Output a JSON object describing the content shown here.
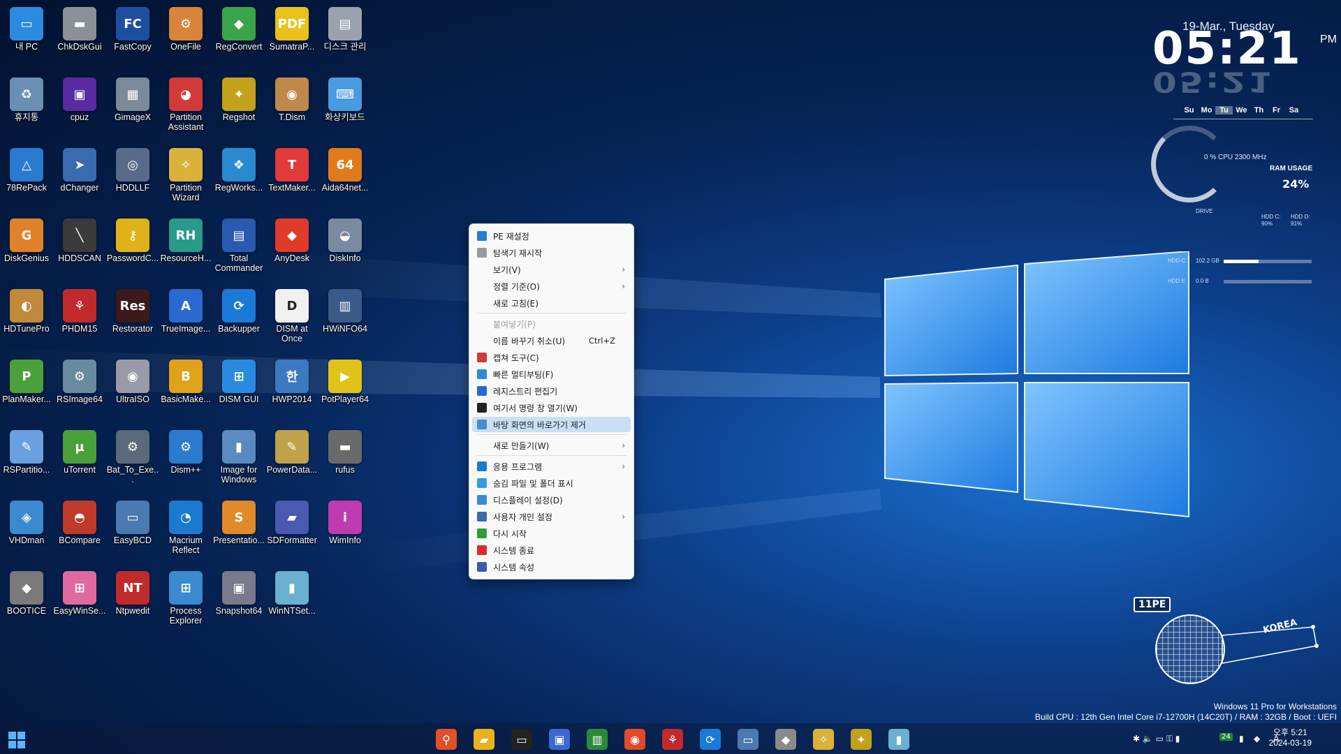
{
  "desktop_icons": [
    {
      "label": "내 PC",
      "glyph": "▭",
      "color": "#2a8be0"
    },
    {
      "label": "ChkDskGui",
      "glyph": "▬",
      "color": "#8a8f98"
    },
    {
      "label": "FastCopy",
      "glyph": "FC",
      "color": "#1d4fa0"
    },
    {
      "label": "OneFile",
      "glyph": "⚙",
      "color": "#d8843a"
    },
    {
      "label": "RegConvert",
      "glyph": "◆",
      "color": "#3aa44a"
    },
    {
      "label": "SumatraP...",
      "glyph": "PDF",
      "color": "#e8c21a"
    },
    {
      "label": "디스크 관리",
      "glyph": "▤",
      "color": "#9aa2ad"
    },
    {
      "label": "휴지통",
      "glyph": "♻",
      "color": "#6a8fb5"
    },
    {
      "label": "cpuz",
      "glyph": "▣",
      "color": "#5a2aa0"
    },
    {
      "label": "GimageX",
      "glyph": "▦",
      "color": "#7a8a9a"
    },
    {
      "label": "Partition Assistant",
      "glyph": "◕",
      "color": "#d23a3a"
    },
    {
      "label": "Regshot",
      "glyph": "✦",
      "color": "#c2a21a"
    },
    {
      "label": "T.Dism",
      "glyph": "◉",
      "color": "#c0884a"
    },
    {
      "label": "화상키보드",
      "glyph": "⌨",
      "color": "#4a9ae0"
    },
    {
      "label": "78RePack",
      "glyph": "△",
      "color": "#2a7ad0"
    },
    {
      "label": "dChanger",
      "glyph": "➤",
      "color": "#3a6ab0"
    },
    {
      "label": "HDDLLF",
      "glyph": "◎",
      "color": "#5a6a8a"
    },
    {
      "label": "Partition Wizard",
      "glyph": "✧",
      "color": "#d8b23a"
    },
    {
      "label": "RegWorks...",
      "glyph": "❖",
      "color": "#2a8ad0"
    },
    {
      "label": "TextMaker...",
      "glyph": "T",
      "color": "#e03a3a"
    },
    {
      "label": "Aida64net...",
      "glyph": "64",
      "color": "#e07a1a"
    },
    {
      "label": "DiskGenius",
      "glyph": "G",
      "color": "#e0822a"
    },
    {
      "label": "HDDSCAN",
      "glyph": "╲",
      "color": "#3a3a3a"
    },
    {
      "label": "PasswordC...",
      "glyph": "⚷",
      "color": "#e0b21a"
    },
    {
      "label": "ResourceH...",
      "glyph": "RH",
      "color": "#2a9a8a"
    },
    {
      "label": "Total Commander",
      "glyph": "▤",
      "color": "#2a5ab0"
    },
    {
      "label": "AnyDesk",
      "glyph": "◆",
      "color": "#e03a2a"
    },
    {
      "label": "DiskInfo",
      "glyph": "◒",
      "color": "#7a8aa0"
    },
    {
      "label": "HDTunePro",
      "glyph": "◐",
      "color": "#c08a3a"
    },
    {
      "label": "PHDM15",
      "glyph": "⚘",
      "color": "#c02a2a"
    },
    {
      "label": "Restorator",
      "glyph": "Res",
      "color": "#3a1a1a"
    },
    {
      "label": "TrueImage...",
      "glyph": "A",
      "color": "#2a6ad0"
    },
    {
      "label": "Backupper",
      "glyph": "⟳",
      "color": "#1a7ad8"
    },
    {
      "label": "DISM at Once",
      "glyph": "D",
      "color": "#f0f0f0"
    },
    {
      "label": "HWiNFO64",
      "glyph": "▥",
      "color": "#3a5a8a"
    },
    {
      "label": "PlanMaker...",
      "glyph": "P",
      "color": "#4aa03a"
    },
    {
      "label": "RSImage64",
      "glyph": "⚙",
      "color": "#6a8aa0"
    },
    {
      "label": "UltraISO",
      "glyph": "◉",
      "color": "#9a9aa8"
    },
    {
      "label": "BasicMake...",
      "glyph": "B",
      "color": "#e0a21a"
    },
    {
      "label": "DISM GUI",
      "glyph": "⊞",
      "color": "#2a8ae0"
    },
    {
      "label": "HWP2014",
      "glyph": "한",
      "color": "#3a7ac0"
    },
    {
      "label": "PotPlayer64",
      "glyph": "▶",
      "color": "#e0c21a"
    },
    {
      "label": "RSPartitio...",
      "glyph": "✎",
      "color": "#6aa0e0"
    },
    {
      "label": "uTorrent",
      "glyph": "µ",
      "color": "#4aa03a"
    },
    {
      "label": "Bat_To_Exe...",
      "glyph": "⚙",
      "color": "#5a6a7a"
    },
    {
      "label": "Dism++",
      "glyph": "⚙",
      "color": "#2a7ad0"
    },
    {
      "label": "Image for Windows",
      "glyph": "▮",
      "color": "#5a8ac0"
    },
    {
      "label": "PowerData...",
      "glyph": "✎",
      "color": "#c0a24a"
    },
    {
      "label": "rufus",
      "glyph": "▬",
      "color": "#6a6a6a"
    },
    {
      "label": "VHDman",
      "glyph": "◈",
      "color": "#3a8ad0"
    },
    {
      "label": "BCompare",
      "glyph": "◓",
      "color": "#c03a2a"
    },
    {
      "label": "EasyBCD",
      "glyph": "▭",
      "color": "#4a7ab0"
    },
    {
      "label": "Macrium Reflect",
      "glyph": "◔",
      "color": "#1a7ad0"
    },
    {
      "label": "Presentatio...",
      "glyph": "S",
      "color": "#e08a2a"
    },
    {
      "label": "SDFormatter",
      "glyph": "▰",
      "color": "#4a5ab0"
    },
    {
      "label": "WimInfo",
      "glyph": "i",
      "color": "#c03ab0"
    },
    {
      "label": "BOOTICE",
      "glyph": "◆",
      "color": "#7a7a7a"
    },
    {
      "label": "EasyWinSe...",
      "glyph": "⊞",
      "color": "#e06aa0"
    },
    {
      "label": "Ntpwedit",
      "glyph": "NT",
      "color": "#c02a2a"
    },
    {
      "label": "Process Explorer",
      "glyph": "⊞",
      "color": "#3a8ad0"
    },
    {
      "label": "Snapshot64",
      "glyph": "▣",
      "color": "#7a7a8a"
    },
    {
      "label": "WinNTSet...",
      "glyph": "▮",
      "color": "#6ab0d0"
    }
  ],
  "context_menu": {
    "items": [
      {
        "label": "PE 재설정",
        "icon_color": "#2a7ad0",
        "shortcut": "",
        "submenu": false,
        "disabled": false
      },
      {
        "label": "탐색기 재시작",
        "icon_color": "#9a9a9a",
        "shortcut": "",
        "submenu": false,
        "disabled": false
      },
      {
        "label": "보기(V)",
        "icon_color": "",
        "shortcut": "",
        "submenu": true,
        "disabled": false
      },
      {
        "label": "정렬 기준(O)",
        "icon_color": "",
        "shortcut": "",
        "submenu": true,
        "disabled": false
      },
      {
        "label": "새로 고침(E)",
        "icon_color": "",
        "shortcut": "",
        "submenu": false,
        "disabled": false
      },
      {
        "label": "붙여넣기(P)",
        "icon_color": "",
        "shortcut": "",
        "submenu": false,
        "disabled": true
      },
      {
        "label": "이름 바꾸기 취소(U)",
        "icon_color": "",
        "shortcut": "Ctrl+Z",
        "submenu": false,
        "disabled": false
      },
      {
        "label": "캡쳐 도구(C)",
        "icon_color": "#d03a3a",
        "shortcut": "",
        "submenu": false,
        "disabled": false
      },
      {
        "label": "빠른 멀티부팅(F)",
        "icon_color": "#2a8ae0",
        "shortcut": "",
        "submenu": false,
        "disabled": false
      },
      {
        "label": "레지스트리 편집기",
        "icon_color": "#2a6ad0",
        "shortcut": "",
        "submenu": false,
        "disabled": false
      },
      {
        "label": "여기서 명령 창 열기(W)",
        "icon_color": "#222222",
        "shortcut": "",
        "submenu": false,
        "disabled": false
      },
      {
        "label": "바탕 화면의 바로가기 제거",
        "icon_color": "#4a8ad0",
        "shortcut": "",
        "submenu": false,
        "disabled": false,
        "highlighted": true
      },
      {
        "label": "새로 만들기(W)",
        "icon_color": "",
        "shortcut": "",
        "submenu": true,
        "disabled": false
      },
      {
        "label": "응용 프로그램",
        "icon_color": "#1a7ad0",
        "shortcut": "",
        "submenu": true,
        "disabled": false
      },
      {
        "label": "숨김 파일 및 폴더 표시",
        "icon_color": "#3a9ae0",
        "shortcut": "",
        "submenu": false,
        "disabled": false
      },
      {
        "label": "디스플레이 설정(D)",
        "icon_color": "#3a8ad0",
        "shortcut": "",
        "submenu": false,
        "disabled": false
      },
      {
        "label": "사용자 개인 설정",
        "icon_color": "#3a6ab0",
        "shortcut": "",
        "submenu": true,
        "disabled": false
      },
      {
        "label": "다시 시작",
        "icon_color": "#2aa03a",
        "shortcut": "",
        "submenu": false,
        "disabled": false
      },
      {
        "label": "시스템 종료",
        "icon_color": "#e02a2a",
        "shortcut": "",
        "submenu": false,
        "disabled": false
      },
      {
        "label": "시스템 속성",
        "icon_color": "#3a5ab0",
        "shortcut": "",
        "submenu": false,
        "disabled": false
      }
    ]
  },
  "clock_widget": {
    "date": "19-Mar., Tuesday",
    "time": "05:21",
    "ampm": "PM",
    "days": [
      "Su",
      "Mo",
      "Tu",
      "We",
      "Th",
      "Fr",
      "Sa"
    ],
    "current_day": "Tu",
    "cpu_text": "0 %  CPU 2300 MHz",
    "ram_label": "RAM USAGE",
    "ram_value": "24%",
    "drive_label": "DRIVE",
    "hdd_c_label": "HDD C:",
    "hdd_c_pct": "90%",
    "hdd_d_label": "HDD D:",
    "hdd_d_pct": "91%",
    "bar1_label": "HDD C",
    "bar1_text": "102.2 GB",
    "bar1_fill": 0.4,
    "bar2_label": "HDD E",
    "bar2_text": "0.0 B",
    "bar2_fill": 0.0
  },
  "branding": {
    "badge": "11PE",
    "region": "KOREA",
    "os_line": "Windows 11 Pro for Workstations",
    "build_line": "Build CPU : 12th Gen Intel Core i7-12700H (14C20T) / RAM : 32GB / Boot : UEFI"
  },
  "taskbar": {
    "apps": [
      {
        "name": "search-icon",
        "glyph": "⚲",
        "color": "#e0502a"
      },
      {
        "name": "file-explorer-icon",
        "glyph": "▰",
        "color": "#e8b21a"
      },
      {
        "name": "command-prompt-icon",
        "glyph": "▭",
        "color": "#222222"
      },
      {
        "name": "save-disk-icon",
        "glyph": "▣",
        "color": "#3a6ad0"
      },
      {
        "name": "memory-icon",
        "glyph": "▥",
        "color": "#2a8a3a"
      },
      {
        "name": "chrome-icon",
        "glyph": "◉",
        "color": "#e04a2a"
      },
      {
        "name": "phdm-icon",
        "glyph": "⚘",
        "color": "#c02a2a"
      },
      {
        "name": "backup-icon",
        "glyph": "⟳",
        "color": "#1a7ad8"
      },
      {
        "name": "computer-icon",
        "glyph": "▭",
        "color": "#4a7ab0"
      },
      {
        "name": "bootice-icon",
        "glyph": "◆",
        "color": "#8a8a8a"
      },
      {
        "name": "partition-wizard-icon",
        "glyph": "✧",
        "color": "#d8b23a"
      },
      {
        "name": "tools-icon",
        "glyph": "✦",
        "color": "#c2a21a"
      },
      {
        "name": "winnt-icon",
        "glyph": "▮",
        "color": "#6ab0d0"
      }
    ],
    "tray_icons": "✱ 🔈 ▭ ⚿ ▮",
    "battery_badge": "24",
    "ime": "A",
    "time": "오후 5:21",
    "date": "2024-03-19"
  }
}
